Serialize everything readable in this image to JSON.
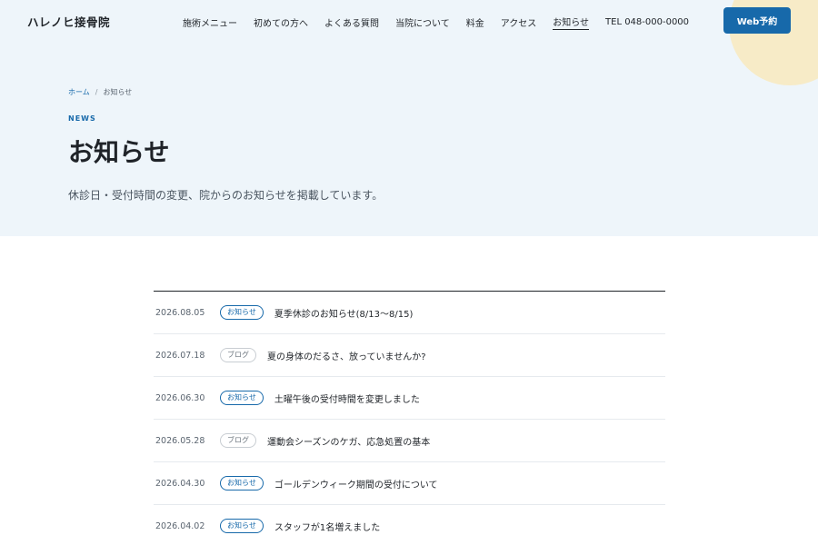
{
  "header": {
    "logo": "ハレノヒ接骨院",
    "nav": [
      {
        "label": "施術メニュー",
        "active": false
      },
      {
        "label": "初めての方へ",
        "active": false
      },
      {
        "label": "よくある質問",
        "active": false
      },
      {
        "label": "当院について",
        "active": false
      },
      {
        "label": "料金",
        "active": false
      },
      {
        "label": "アクセス",
        "active": false
      },
      {
        "label": "お知らせ",
        "active": true
      }
    ],
    "tel": "TEL 048-000-0000",
    "cta": "Web予約"
  },
  "hero": {
    "breadcrumb": {
      "home": "ホーム",
      "separator": "/",
      "current": "お知らせ"
    },
    "eyebrow": "NEWS",
    "title": "お知らせ",
    "description": "休診日・受付時間の変更、院からのお知らせを掲載しています。"
  },
  "news": [
    {
      "date": "2026.08.05",
      "category": "お知らせ",
      "type": "news",
      "title": "夏季休診のお知らせ(8/13〜8/15)"
    },
    {
      "date": "2026.07.18",
      "category": "ブログ",
      "type": "blog",
      "title": "夏の身体のだるさ、放っていませんか?"
    },
    {
      "date": "2026.06.30",
      "category": "お知らせ",
      "type": "news",
      "title": "土曜午後の受付時間を変更しました"
    },
    {
      "date": "2026.05.28",
      "category": "ブログ",
      "type": "blog",
      "title": "運動会シーズンのケガ、応急処置の基本"
    },
    {
      "date": "2026.04.30",
      "category": "お知らせ",
      "type": "news",
      "title": "ゴールデンウィーク期間の受付について"
    },
    {
      "date": "2026.04.02",
      "category": "お知らせ",
      "type": "news",
      "title": "スタッフが1名増えました"
    }
  ],
  "colors": {
    "accent": "#1769aa",
    "hero_bg": "#eef5fa",
    "circle": "#f7ebc7"
  }
}
